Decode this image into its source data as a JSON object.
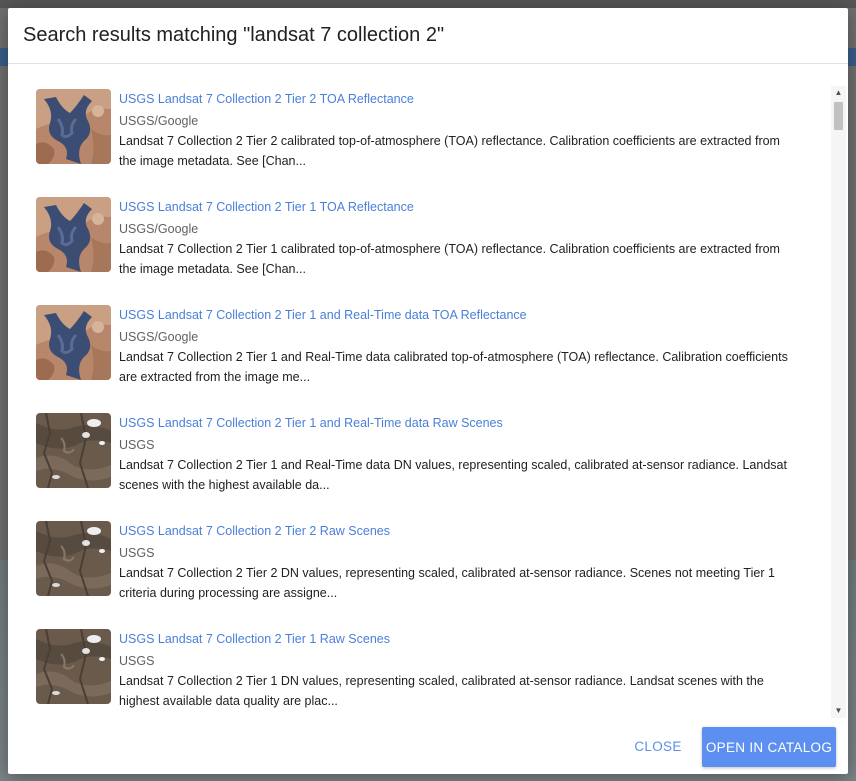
{
  "dialog": {
    "title": "Search results matching \"landsat 7 collection 2\"",
    "close_label": "CLOSE",
    "open_label": "OPEN IN CATALOG"
  },
  "results": [
    {
      "title": "USGS Landsat 7 Collection 2 Tier 2 TOA Reflectance",
      "provider": "USGS/Google",
      "description": "Landsat 7 Collection 2 Tier 2 calibrated top-of-atmosphere (TOA) reflectance. Calibration coefficients are extracted from the image metadata. See [Chan...",
      "thumbnail": "toa"
    },
    {
      "title": "USGS Landsat 7 Collection 2 Tier 1 TOA Reflectance",
      "provider": "USGS/Google",
      "description": "Landsat 7 Collection 2 Tier 1 calibrated top-of-atmosphere (TOA) reflectance. Calibration coefficients are extracted from the image metadata. See [Chan...",
      "thumbnail": "toa"
    },
    {
      "title": "USGS Landsat 7 Collection 2 Tier 1 and Real-Time data TOA Reflectance",
      "provider": "USGS/Google",
      "description": "Landsat 7 Collection 2 Tier 1 and Real-Time data calibrated top-of-atmosphere (TOA) reflectance. Calibration coefficients are extracted from the image me...",
      "thumbnail": "toa"
    },
    {
      "title": "USGS Landsat 7 Collection 2 Tier 1 and Real-Time data Raw Scenes",
      "provider": "USGS",
      "description": "Landsat 7 Collection 2 Tier 1 and Real-Time data DN values, representing scaled, calibrated at-sensor radiance. Landsat scenes with the highest available da...",
      "thumbnail": "raw"
    },
    {
      "title": "USGS Landsat 7 Collection 2 Tier 2 Raw Scenes",
      "provider": "USGS",
      "description": "Landsat 7 Collection 2 Tier 2 DN values, representing scaled, calibrated at-sensor radiance. Scenes not meeting Tier 1 criteria during processing are assigne...",
      "thumbnail": "raw"
    },
    {
      "title": "USGS Landsat 7 Collection 2 Tier 1 Raw Scenes",
      "provider": "USGS",
      "description": "Landsat 7 Collection 2 Tier 1 DN values, representing scaled, calibrated at-sensor radiance. Landsat scenes with the highest available data quality are plac...",
      "thumbnail": "raw"
    }
  ],
  "colors": {
    "link": "#4a7fd9",
    "primary_button": "#5c8ff0"
  }
}
